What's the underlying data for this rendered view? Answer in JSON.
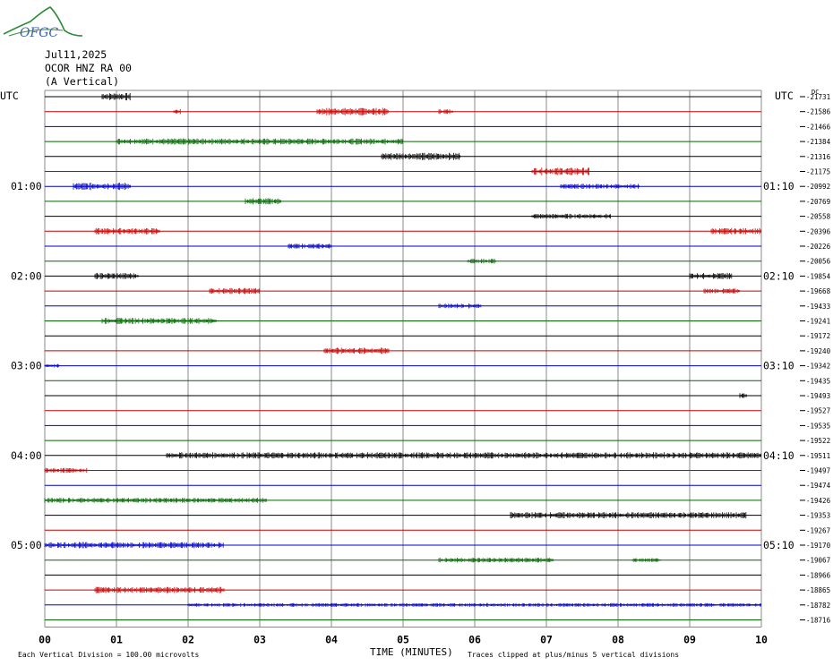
{
  "header": {
    "logo_text": "OFGC",
    "date": "Jul11,2025",
    "station": "OCOR HNZ RA 00",
    "component": "(A Vertical)"
  },
  "chart_data": {
    "type": "line",
    "title": "Jul11,2025",
    "subtitle": "OCOR HNZ RA 00 (A Vertical)",
    "xlabel": "TIME (MINUTES)",
    "xlim": [
      0,
      10
    ],
    "x_ticks": [
      "00",
      "01",
      "02",
      "03",
      "04",
      "05",
      "06",
      "07",
      "08",
      "09",
      "10"
    ],
    "left_axis_label": "UTC",
    "right_axis_label": "UTC",
    "right_offset_header": "DC",
    "left_time_labels": [
      {
        "row": 6,
        "label": "01:00"
      },
      {
        "row": 12,
        "label": "02:00"
      },
      {
        "row": 18,
        "label": "03:00"
      },
      {
        "row": 24,
        "label": "04:00"
      },
      {
        "row": 30,
        "label": "05:00"
      }
    ],
    "right_time_labels": [
      {
        "row": 6,
        "label": "01:10"
      },
      {
        "row": 12,
        "label": "02:10"
      },
      {
        "row": 18,
        "label": "03:10"
      },
      {
        "row": 24,
        "label": "04:10"
      },
      {
        "row": 30,
        "label": "05:10"
      }
    ],
    "trace_colors": [
      "#000000",
      "#cc0000",
      "#0000cc",
      "#006600"
    ],
    "dc_offsets": [
      "-21731",
      "-21586",
      "-21466",
      "-21384",
      "-21316",
      "-21175",
      "-20992",
      "-20769",
      "-20558",
      "-20396",
      "-20226",
      "-20056",
      "-19854",
      "-19668",
      "-19433",
      "-19241",
      "-19172",
      "-19240",
      "-19342",
      "-19435",
      "-19493",
      "-19527",
      "-19535",
      "-19522",
      "-19511",
      "-19497",
      "-19474",
      "-19426",
      "-19353",
      "-19267",
      "-19170",
      "-19067",
      "-18966",
      "-18865",
      "-18782",
      "-18716"
    ],
    "trace_noise": [
      [
        [
          0.8,
          1.2,
          3
        ]
      ],
      [
        [
          1.8,
          1.9,
          2
        ],
        [
          3.8,
          4.8,
          3
        ],
        [
          5.5,
          5.7,
          2
        ]
      ],
      [],
      [
        [
          1.0,
          5.0,
          2.5
        ]
      ],
      [
        [
          4.7,
          5.8,
          3
        ]
      ],
      [
        [
          6.8,
          7.6,
          3
        ]
      ],
      [
        [
          0.4,
          1.2,
          3
        ],
        [
          7.2,
          8.3,
          2
        ]
      ],
      [
        [
          2.8,
          3.3,
          2.5
        ]
      ],
      [
        [
          6.8,
          7.9,
          2
        ]
      ],
      [
        [
          0.7,
          1.6,
          2.5
        ],
        [
          9.3,
          10,
          2.5
        ]
      ],
      [
        [
          3.4,
          4.0,
          2
        ]
      ],
      [
        [
          5.9,
          6.3,
          2
        ]
      ],
      [
        [
          0.7,
          1.3,
          2.5
        ],
        [
          9.0,
          9.6,
          2.5
        ]
      ],
      [
        [
          2.3,
          3.0,
          2.5
        ],
        [
          9.2,
          9.7,
          2
        ]
      ],
      [
        [
          5.5,
          6.1,
          2
        ]
      ],
      [
        [
          0.8,
          2.4,
          2.5
        ]
      ],
      [],
      [
        [
          3.9,
          4.8,
          2.5
        ]
      ],
      [
        [
          0.0,
          0.2,
          1.5
        ]
      ],
      [],
      [
        [
          9.7,
          9.8,
          2
        ]
      ],
      [],
      [],
      [],
      [
        [
          1.7,
          10,
          2.5
        ]
      ],
      [
        [
          0.0,
          0.6,
          2
        ]
      ],
      [],
      [
        [
          0.0,
          3.1,
          2
        ]
      ],
      [
        [
          6.5,
          9.8,
          2.5
        ]
      ],
      [],
      [
        [
          0.0,
          2.5,
          2.5
        ]
      ],
      [
        [
          5.5,
          7.1,
          2
        ],
        [
          8.2,
          8.6,
          1.5
        ]
      ],
      [],
      [
        [
          0.7,
          2.5,
          2.5
        ]
      ],
      [
        [
          2.0,
          10,
          1.5
        ]
      ],
      []
    ],
    "footer_left": "Each Vertical Division =  100.00 microvolts",
    "footer_right": "Traces clipped at plus/minus 5 vertical divisions"
  }
}
